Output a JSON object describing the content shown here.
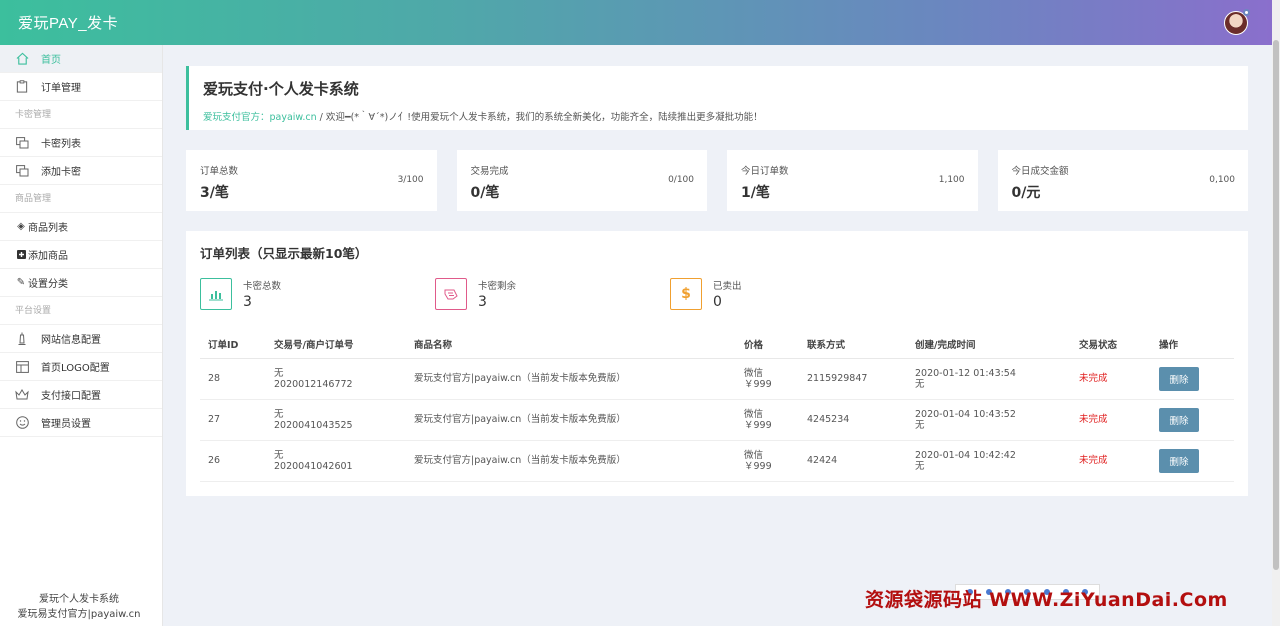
{
  "header": {
    "brand": "爱玩PAY_发卡"
  },
  "sidebar": {
    "items": [
      {
        "label": "首页",
        "icon": "home-icon",
        "active": true
      },
      {
        "label": "订单管理",
        "icon": "clipboard-icon"
      }
    ],
    "sections": [
      {
        "label": "卡密管理",
        "items": [
          {
            "label": "卡密列表",
            "icon": "copy-icon"
          },
          {
            "label": "添加卡密",
            "icon": "copy-icon"
          }
        ]
      },
      {
        "label": "商品管理",
        "items": [
          {
            "label": "商品列表",
            "icon": "diamond-icon"
          },
          {
            "label": "添加商品",
            "icon": "plus-square-icon"
          },
          {
            "label": "设置分类",
            "icon": "edit-icon"
          }
        ]
      },
      {
        "label": "平台设置",
        "items": [
          {
            "label": "网站信息配置",
            "icon": "tower-icon"
          },
          {
            "label": "首页LOGO配置",
            "icon": "layout-icon"
          },
          {
            "label": "支付接口配置",
            "icon": "crown-icon"
          },
          {
            "label": "管理员设置",
            "icon": "smile-icon"
          }
        ]
      }
    ],
    "footer": {
      "line1": "爱玩个人发卡系统",
      "line2": "爱玩易支付官方|payaiw.cn"
    }
  },
  "welcome": {
    "title": "爱玩支付·个人发卡系统",
    "site_label": "爱玩支付官方：payaiw.cn",
    "separator": "/",
    "message": "欢迎━(*｀∀´*)ノ亻!使用爱玩个人发卡系统，我们的系统全新美化，功能齐全，陆续推出更多凝批功能！"
  },
  "stats": [
    {
      "label": "订单总数",
      "value": "3/笔",
      "ratio": "3/100"
    },
    {
      "label": "交易完成",
      "value": "0/笔",
      "ratio": "0/100"
    },
    {
      "label": "今日订单数",
      "value": "1/笔",
      "ratio": "1,100"
    },
    {
      "label": "今日成交金额",
      "value": "0/元",
      "ratio": "0,100"
    }
  ],
  "orders_panel": {
    "title": "订单列表（只显示最新10笔）",
    "summary": [
      {
        "label": "卡密总数",
        "value": "3",
        "icon": "bar-chart-icon",
        "color": "#3cbf9d"
      },
      {
        "label": "卡密剩余",
        "value": "3",
        "icon": "ticket-icon",
        "color": "#e05a8a"
      },
      {
        "label": "已卖出",
        "value": "0",
        "icon": "dollar-icon",
        "color": "#f0a030"
      }
    ],
    "columns": [
      "订单ID",
      "交易号/商户订单号",
      "商品名称",
      "价格",
      "联系方式",
      "创建/完成时间",
      "交易状态",
      "操作"
    ],
    "rows": [
      {
        "id": "28",
        "trade_no": "无",
        "order_no": "2020012146772",
        "product": "爱玩支付官方|payaiw.cn（当前发卡版本免费版）",
        "pay": "微信",
        "price": "￥999",
        "contact": "2115929847",
        "created": "2020-01-12 01:43:54",
        "finished": "无",
        "status": "未完成",
        "action": "删除"
      },
      {
        "id": "27",
        "trade_no": "无",
        "order_no": "2020041043525",
        "product": "爱玩支付官方|payaiw.cn（当前发卡版本免费版）",
        "pay": "微信",
        "price": "￥999",
        "contact": "4245234",
        "created": "2020-01-04 10:43:52",
        "finished": "无",
        "status": "未完成",
        "action": "删除"
      },
      {
        "id": "26",
        "trade_no": "无",
        "order_no": "2020041042601",
        "product": "爱玩支付官方|payaiw.cn（当前发卡版本免费版）",
        "pay": "微信",
        "price": "￥999",
        "contact": "42424",
        "created": "2020-01-04 10:42:42",
        "finished": "无",
        "status": "未完成",
        "action": "删除"
      }
    ]
  },
  "watermark": {
    "text": "资源袋源码站 WWW.ZiYuanDai.Com"
  },
  "colors": {
    "accent": "#3cbf9d",
    "danger": "#e02020",
    "button": "#5b8fad"
  }
}
